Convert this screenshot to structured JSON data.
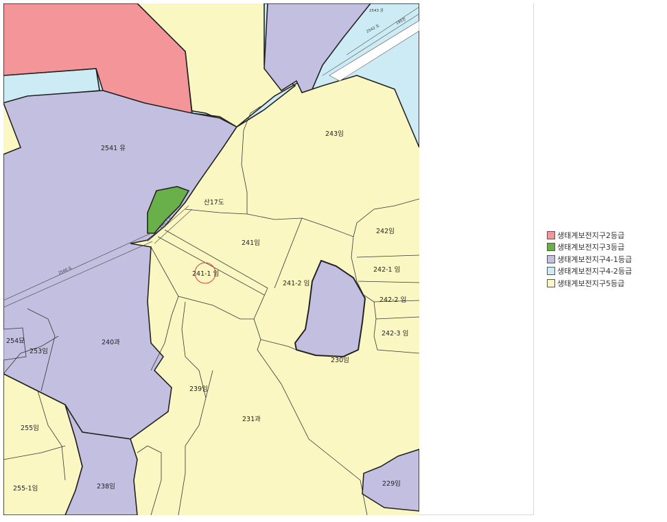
{
  "legend": {
    "items": [
      {
        "label": "생태계보전지구2등급",
        "color": "#f4959a"
      },
      {
        "label": "생태계보전지구3등급",
        "color": "#6ab04a"
      },
      {
        "label": "생태계보전지구4-1등급",
        "color": "#c3bfe0"
      },
      {
        "label": "생태계보전지구4-2등급",
        "color": "#cdebf4"
      },
      {
        "label": "생태계보전지구5등급",
        "color": "#fbf7c2"
      }
    ]
  },
  "map": {
    "selected_parcel": "241-1 임",
    "parcels": [
      {
        "id": "p2541",
        "label": "2541 유"
      },
      {
        "id": "p243",
        "label": "243임"
      },
      {
        "id": "ps17",
        "label": "산17도"
      },
      {
        "id": "p241",
        "label": "241임"
      },
      {
        "id": "p242",
        "label": "242임"
      },
      {
        "id": "p2421",
        "label": "242-1 임"
      },
      {
        "id": "p2411",
        "label": "241-1 임"
      },
      {
        "id": "p2412",
        "label": "241-2 임"
      },
      {
        "id": "p2422",
        "label": "242-2 임"
      },
      {
        "id": "p2423",
        "label": "242-3 임"
      },
      {
        "id": "p254",
        "label": "254묘"
      },
      {
        "id": "p253",
        "label": "253임"
      },
      {
        "id": "p240",
        "label": "240과"
      },
      {
        "id": "p230",
        "label": "230임"
      },
      {
        "id": "p239",
        "label": "239임"
      },
      {
        "id": "p231",
        "label": "231과"
      },
      {
        "id": "p255",
        "label": "255임"
      },
      {
        "id": "p2551",
        "label": "255-1임"
      },
      {
        "id": "p238",
        "label": "238임"
      },
      {
        "id": "p229",
        "label": "229임"
      }
    ],
    "road_labels": [
      {
        "id": "r2543",
        "label": "2543 공"
      },
      {
        "id": "r2542",
        "label": "2542 도"
      },
      {
        "id": "r195",
        "label": "195전"
      },
      {
        "id": "r2540",
        "label": "2540 도"
      },
      {
        "id": "r_small",
        "label": "195-1 도"
      }
    ]
  }
}
